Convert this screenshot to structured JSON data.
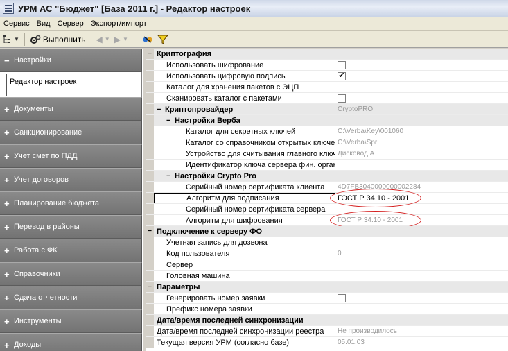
{
  "window": {
    "title": "УРМ АС \"Бюджет\" [База 2011 г.] - Редактор настроек"
  },
  "menu": [
    "Сервис",
    "Вид",
    "Сервер",
    "Экспорт/импорт"
  ],
  "toolbar": {
    "execute_label": "Выполнить"
  },
  "nav": {
    "open_section": {
      "sign": "−",
      "label": "Настройки",
      "sub_item": "Редактор настроек"
    },
    "sections": [
      {
        "sign": "+",
        "label": "Документы"
      },
      {
        "sign": "+",
        "label": "Санкционирование"
      },
      {
        "sign": "+",
        "label": "Учет смет по ПДД"
      },
      {
        "sign": "+",
        "label": "Учет договоров"
      },
      {
        "sign": "+",
        "label": "Планирование бюджета"
      },
      {
        "sign": "+",
        "label": "Перевод в районы"
      },
      {
        "sign": "+",
        "label": "Работа с ФК"
      },
      {
        "sign": "+",
        "label": "Справочники"
      },
      {
        "sign": "+",
        "label": "Сдача отчетности"
      },
      {
        "sign": "+",
        "label": "Инструменты"
      },
      {
        "sign": "+",
        "label": "Доходы"
      }
    ]
  },
  "grid": {
    "rows": [
      {
        "type": "category",
        "level": 0,
        "sign": "−",
        "name": "Криптография",
        "value": ""
      },
      {
        "type": "property",
        "level": 1,
        "name": "Использовать шифрование",
        "checkbox": true,
        "checked": false
      },
      {
        "type": "property",
        "level": 1,
        "name": "Использовать цифровую подпись",
        "checkbox": true,
        "checked": true
      },
      {
        "type": "property",
        "level": 1,
        "name": "Каталог для хранения пакетов с ЭЦП",
        "value": ""
      },
      {
        "type": "property",
        "level": 1,
        "name": "Сканировать каталог с пакетами",
        "checkbox": true,
        "checked": false
      },
      {
        "type": "category",
        "level": 1,
        "sign": "−",
        "name": "Криптопровайдер",
        "value": "CryptoPRO"
      },
      {
        "type": "category",
        "level": 2,
        "sign": "−",
        "name": "Настройки Верба",
        "value": ""
      },
      {
        "type": "property",
        "level": 3,
        "name": "Каталог для секретных ключей",
        "value": "C:\\Verba\\Key\\001060"
      },
      {
        "type": "property",
        "level": 3,
        "name": "Каталог со справочником открытых ключей",
        "value": "C:\\Verba\\Spr"
      },
      {
        "type": "property",
        "level": 3,
        "name": "Устройство для считывания главного ключа",
        "value": "Дисковод А"
      },
      {
        "type": "property",
        "level": 3,
        "name": "Идентификатор ключа сервера фин. органа",
        "value": ""
      },
      {
        "type": "category",
        "level": 2,
        "sign": "−",
        "name": "Настройки Crypto Pro",
        "value": ""
      },
      {
        "type": "property",
        "level": 3,
        "name": "Серийный номер сертификата клиента",
        "value": "4D7FB3040000000002284"
      },
      {
        "type": "property",
        "level": 3,
        "name": "Алгоритм для подписания",
        "value": "ГОСТ Р 34.10 - 2001",
        "selected": true,
        "editing": true,
        "circled": true
      },
      {
        "type": "property",
        "level": 3,
        "name": "Серийный номер сертификата сервера",
        "value": ""
      },
      {
        "type": "property",
        "level": 3,
        "name": "Алгоритм для шифрования",
        "value": "ГОСТ Р 34.10 - 2001",
        "circled": true
      },
      {
        "type": "category",
        "level": 0,
        "sign": "−",
        "name": "Подключение к серверу ФО",
        "value": ""
      },
      {
        "type": "property",
        "level": 1,
        "name": "Учетная запись для дозвона",
        "value": ""
      },
      {
        "type": "property",
        "level": 1,
        "name": "Код пользователя",
        "value": "0"
      },
      {
        "type": "property",
        "level": 1,
        "name": "Сервер",
        "value": ""
      },
      {
        "type": "property",
        "level": 1,
        "name": "Головная машина",
        "value": ""
      },
      {
        "type": "category",
        "level": 0,
        "sign": "−",
        "name": "Параметры",
        "value": ""
      },
      {
        "type": "property",
        "level": 1,
        "name": "Генерировать номер заявки",
        "checkbox": true,
        "checked": false
      },
      {
        "type": "property",
        "level": 1,
        "name": "Префикс номера заявки",
        "value": ""
      },
      {
        "type": "category",
        "level": 0,
        "sign": "",
        "name": "Дата/время последней синхронизации",
        "value": ""
      },
      {
        "type": "property",
        "level": 0,
        "name": "Дата/время последней синхронизации реестра",
        "value": "Не производилось"
      },
      {
        "type": "property",
        "level": 0,
        "name": "Текущая версия УРМ (согласно базе)",
        "value": "05.01.03"
      }
    ]
  },
  "colors": {
    "annotation": "#d42020",
    "nav_header": "#7f7f7f"
  }
}
